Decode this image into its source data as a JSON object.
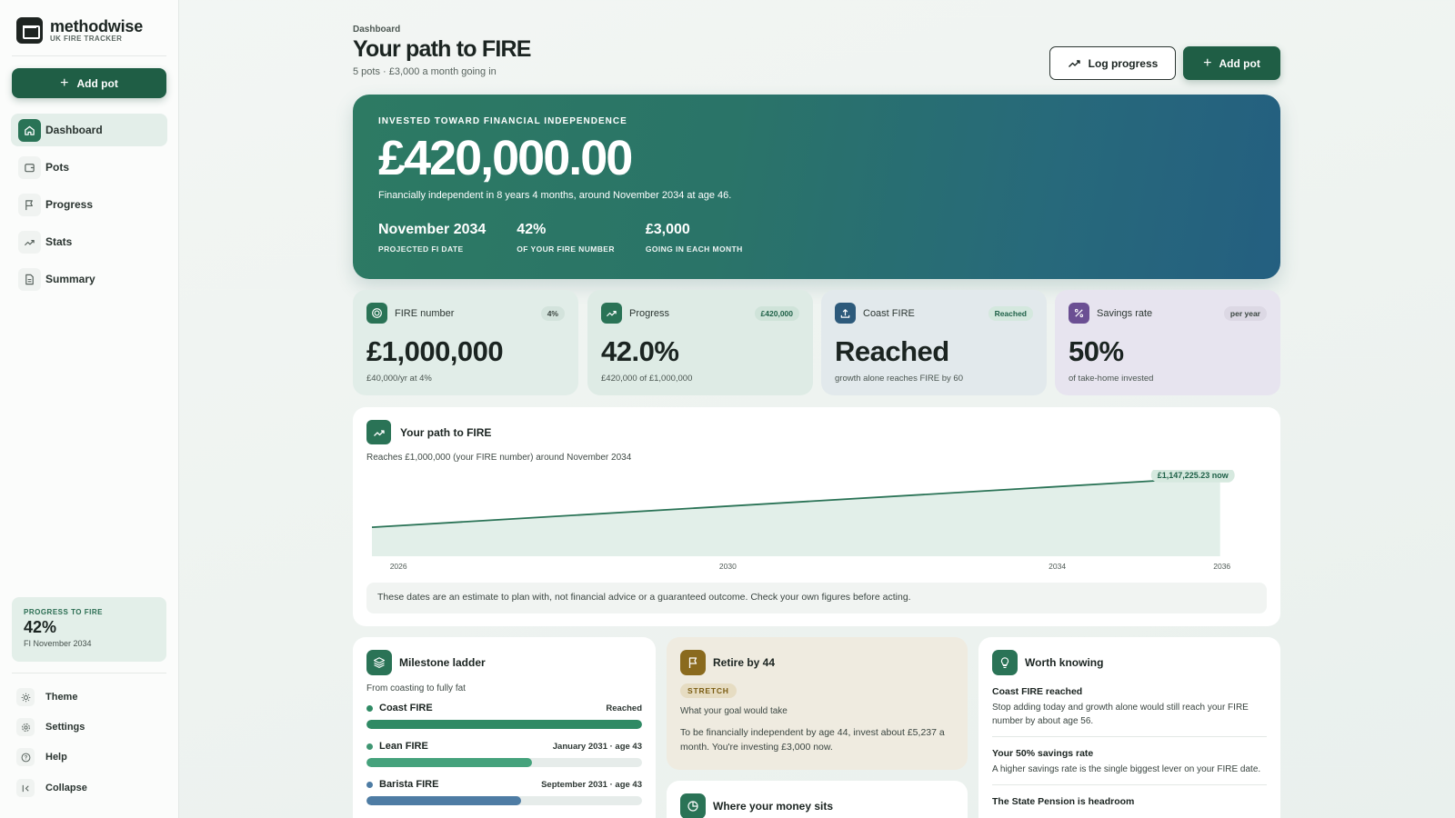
{
  "brand": {
    "name": "methodwise",
    "tagline": "UK FIRE TRACKER"
  },
  "sidebar": {
    "add_pot_label": "Add pot",
    "nav": [
      {
        "label": "Dashboard",
        "icon": "home-icon"
      },
      {
        "label": "Pots",
        "icon": "wallet-icon"
      },
      {
        "label": "Progress",
        "icon": "flag-icon"
      },
      {
        "label": "Stats",
        "icon": "trend-icon"
      },
      {
        "label": "Summary",
        "icon": "document-icon"
      }
    ],
    "progress": {
      "label": "PROGRESS TO FIRE",
      "value": "42%",
      "sub": "FI November 2034"
    },
    "bottom": [
      {
        "label": "Theme",
        "icon": "sun-icon"
      },
      {
        "label": "Settings",
        "icon": "gear-icon"
      },
      {
        "label": "Help",
        "icon": "help-icon"
      },
      {
        "label": "Collapse",
        "icon": "collapse-icon"
      }
    ]
  },
  "header": {
    "breadcrumb": "Dashboard",
    "title": "Your path to FIRE",
    "subtitle": "5 pots · £3,000 a month going in",
    "log_progress_label": "Log progress",
    "add_pot_label": "Add pot"
  },
  "hero": {
    "label": "INVESTED TOWARD FINANCIAL INDEPENDENCE",
    "amount": "£420,000.00",
    "description": "Financially independent in 8 years 4 months, around November 2034 at age 46.",
    "stats": [
      {
        "value": "November 2034",
        "label": "PROJECTED FI DATE"
      },
      {
        "value": "42%",
        "label": "OF YOUR FIRE NUMBER"
      },
      {
        "value": "£3,000",
        "label": "GOING IN EACH MONTH"
      }
    ]
  },
  "cards": [
    {
      "title": "FIRE number",
      "badge": "4%",
      "value": "£1,000,000",
      "sub": "£40,000/yr at 4%",
      "icon": "target-icon"
    },
    {
      "title": "Progress",
      "badge": "£420,000",
      "value": "42.0%",
      "sub": "£420,000 of £1,000,000",
      "icon": "trend-icon"
    },
    {
      "title": "Coast FIRE",
      "badge": "Reached",
      "value": "Reached",
      "sub": "growth alone reaches FIRE by 60",
      "icon": "upload-icon"
    },
    {
      "title": "Savings rate",
      "badge": "per year",
      "value": "50%",
      "sub": "of take-home invested",
      "icon": "percent-icon"
    }
  ],
  "path_chart": {
    "title": "Your path to FIRE",
    "subtitle": "Reaches £1,000,000 (your FIRE number) around November 2034",
    "disclaimer": "These dates are an estimate to plan with, not financial advice or a guaranteed outcome. Check your own figures before acting."
  },
  "chart_data": {
    "type": "area",
    "title": "Your path to FIRE",
    "x_ticks": [
      "2026",
      "2030",
      "2034",
      "2036"
    ],
    "x_range": [
      2025.7,
      2036.5
    ],
    "series": [
      {
        "x": [
          2025.7,
          2036.0
        ],
        "values": [
          420000,
          1147225.23
        ]
      }
    ],
    "annotation": "£1,147,225.23 now",
    "ylim": [
      0,
      1250000
    ],
    "grid": false,
    "accent": "#2a7356"
  },
  "milestones": {
    "title": "Milestone ladder",
    "subtitle": "From coasting to fully fat",
    "items": [
      {
        "name": "Coast FIRE",
        "status": "Reached",
        "fill": 1.0,
        "color": "#2f8a64"
      },
      {
        "name": "Lean FIRE",
        "status": "January 2031 · age 43",
        "fill": 0.6,
        "color": "#45a27c"
      },
      {
        "name": "Barista FIRE",
        "status": "September 2031 · age 43",
        "fill": 0.56,
        "color": "#4e7ca4"
      }
    ]
  },
  "retire": {
    "title": "Retire by 44",
    "tag": "STRETCH",
    "subtitle": "What your goal would take",
    "text": "To be financially independent by age 44, invest about £5,237 a month. You're investing £3,000 now."
  },
  "money": {
    "title": "Where your money sits"
  },
  "worth": {
    "title": "Worth knowing",
    "items": [
      {
        "title": "Coast FIRE reached",
        "text": "Stop adding today and growth alone would still reach your FIRE number by about age 56."
      },
      {
        "title": "Your 50% savings rate",
        "text": "A higher savings rate is the single biggest lever on your FIRE date."
      },
      {
        "title": "The State Pension is headroom",
        "text": ""
      }
    ]
  }
}
